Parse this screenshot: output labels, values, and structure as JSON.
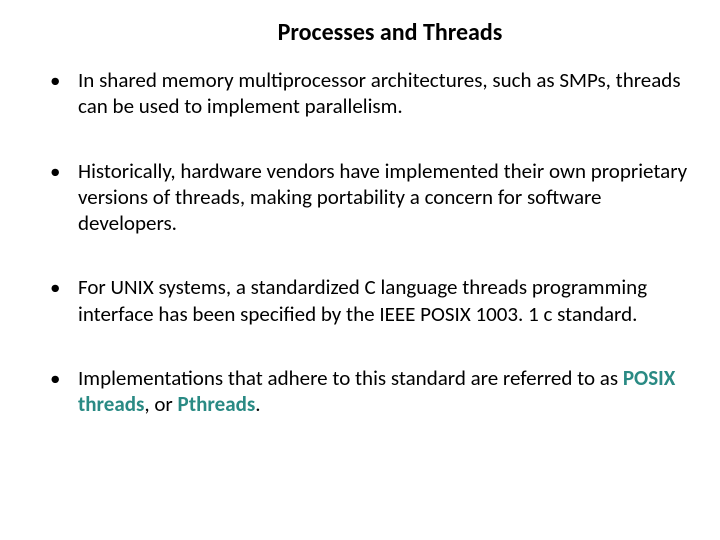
{
  "title": "Processes and Threads",
  "bullets": [
    {
      "text": "In shared memory multiprocessor architectures, such as SMPs, threads can be used to implement parallelism."
    },
    {
      "text": "Historically, hardware vendors have implemented their own proprietary versions of threads, making portability a concern for software developers."
    },
    {
      "text": "For UNIX systems, a standardized C language threads programming interface has been specified by the IEEE POSIX 1003. 1 c standard."
    },
    {
      "prefix": " Implementations that adhere to this standard are referred to as ",
      "strong1": "POSIX threads",
      "mid": ", or ",
      "strong2": "Pthreads",
      "suffix": "."
    }
  ]
}
